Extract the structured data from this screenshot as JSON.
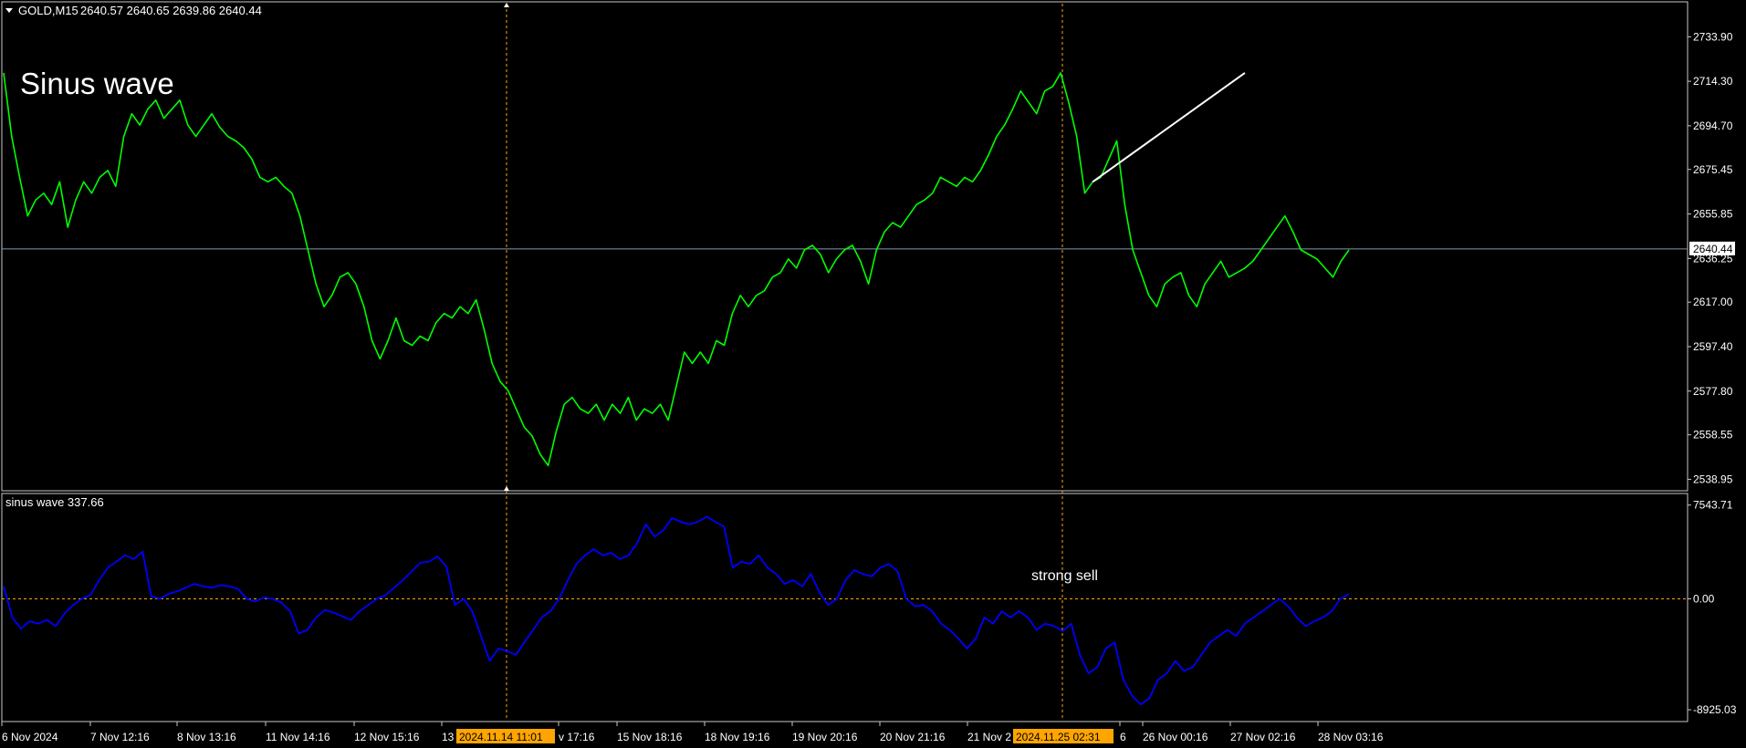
{
  "header": {
    "symbol": "GOLD,M15",
    "ohlc": "2640.57 2640.65 2639.86 2640.44"
  },
  "annotations": {
    "main_label": "Sinus wave",
    "signal_label": "strong sell",
    "current_price_tag": "2640.44",
    "cursor_tags": [
      "2024.11.14 11:01",
      "2024.11.25 02:31"
    ]
  },
  "indicator": {
    "title": "sinus wave 337.66"
  },
  "colors": {
    "background": "#000000",
    "price_line": "#00ff00",
    "indicator_line": "#0000ff",
    "crosshair": "#ffa500",
    "current_price_line": "#7f9bb3",
    "trendline": "#ffffff"
  },
  "chart_data": [
    {
      "type": "line",
      "title": "GOLD,M15",
      "series": [
        {
          "values": [
            2718,
            2690,
            2672,
            2655,
            2662,
            2665,
            2660,
            2670,
            2650,
            2662,
            2670,
            2665,
            2672,
            2675,
            2668,
            2690,
            2700,
            2695,
            2702,
            2706,
            2698,
            2702,
            2706,
            2695,
            2690,
            2695,
            2700,
            2694,
            2690,
            2688,
            2685,
            2680,
            2672,
            2670,
            2672,
            2668,
            2665,
            2655,
            2640,
            2625,
            2615,
            2620,
            2628,
            2630,
            2625,
            2615,
            2600,
            2592,
            2600,
            2610,
            2600,
            2598,
            2602,
            2600,
            2608,
            2612,
            2610,
            2615,
            2612,
            2618,
            2605,
            2590,
            2582,
            2578,
            2570,
            2562,
            2558,
            2550,
            2545,
            2560,
            2572,
            2575,
            2570,
            2568,
            2572,
            2565,
            2572,
            2568,
            2575,
            2565,
            2570,
            2568,
            2572,
            2565,
            2580,
            2595,
            2590,
            2595,
            2590,
            2600,
            2598,
            2612,
            2620,
            2615,
            2620,
            2622,
            2628,
            2630,
            2636,
            2632,
            2640,
            2642,
            2638,
            2630,
            2636,
            2640,
            2642,
            2635,
            2625,
            2640,
            2648,
            2652,
            2650,
            2655,
            2660,
            2662,
            2665,
            2672,
            2670,
            2668,
            2672,
            2670,
            2675,
            2682,
            2690,
            2695,
            2702,
            2710,
            2705,
            2700,
            2710,
            2712,
            2718,
            2705,
            2690,
            2665,
            2670,
            2672,
            2680,
            2688,
            2660,
            2640,
            2630,
            2620,
            2615,
            2625,
            2628,
            2630,
            2620,
            2615,
            2625,
            2630,
            2635,
            2628,
            2630,
            2632,
            2635,
            2640,
            2645,
            2650,
            2655,
            2648,
            2640,
            2638,
            2636,
            2632,
            2628,
            2635,
            2640
          ]
        }
      ],
      "ylim": [
        2533.9,
        2748.5
      ],
      "y_ticks": [
        "2733.90",
        "2714.30",
        "2694.70",
        "2675.45",
        "2655.85",
        "2636.25",
        "2617.00",
        "2597.40",
        "2577.80",
        "2558.55",
        "2538.95"
      ],
      "current_price": 2640.44,
      "trendline": {
        "from": [
          136,
          2670
        ],
        "to": [
          155,
          2718
        ]
      },
      "x_tick_labels": [
        "6 Nov 2024",
        "7 Nov 12:16",
        "8 Nov 13:16",
        "11 Nov 14:16",
        "12 Nov 15:16",
        "13",
        "v 17:16",
        "15 Nov 18:16",
        "18 Nov 19:16",
        "19 Nov 20:16",
        "20 Nov 21:16",
        "21 Nov 2",
        "6",
        "26 Nov 00:16",
        "27 Nov 02:16",
        "28 Nov 03:16"
      ]
    },
    {
      "type": "line",
      "title": "sinus wave 337.66",
      "series": [
        {
          "values": [
            1000,
            -1500,
            -2400,
            -1800,
            -2000,
            -1700,
            -2200,
            -1200,
            -500,
            0,
            300,
            1500,
            2500,
            3000,
            3500,
            3200,
            3800,
            200,
            0,
            400,
            600,
            900,
            1200,
            1000,
            900,
            1100,
            1000,
            800,
            0,
            -200,
            100,
            0,
            -300,
            -1000,
            -2800,
            -2500,
            -1500,
            -900,
            -1100,
            -1400,
            -1700,
            -1000,
            -500,
            0,
            300,
            900,
            1500,
            2200,
            2900,
            3000,
            3400,
            2600,
            -500,
            0,
            -1000,
            -3000,
            -5000,
            -4000,
            -4200,
            -4500,
            -3500,
            -2500,
            -1500,
            -1000,
            0,
            1500,
            2800,
            3500,
            4000,
            3500,
            3700,
            3200,
            3500,
            4500,
            6000,
            5000,
            5500,
            6500,
            6200,
            6000,
            6200,
            6600,
            6200,
            5800,
            2500,
            3000,
            2800,
            3500,
            2500,
            2000,
            1200,
            1500,
            1000,
            2000,
            500,
            -500,
            0,
            1500,
            2300,
            2000,
            1800,
            2500,
            2800,
            2200,
            0,
            -600,
            -500,
            -1000,
            -2000,
            -2500,
            -3200,
            -4000,
            -3200,
            -1500,
            -2000,
            -1000,
            -1500,
            -1000,
            -1500,
            -2500,
            -2000,
            -2200,
            -2600,
            -2000,
            -4500,
            -6000,
            -5500,
            -4000,
            -3500,
            -6500,
            -7800,
            -8500,
            -8000,
            -6500,
            -6000,
            -5000,
            -5800,
            -5500,
            -4500,
            -3500,
            -3000,
            -2500,
            -3000,
            -2000,
            -1500,
            -1000,
            -500,
            0,
            -600,
            -1500,
            -2200,
            -1800,
            -1500,
            -1000,
            0,
            400
          ],
          "color": "#0000ff"
        }
      ],
      "ylim": [
        -9800,
        8400
      ],
      "y_ticks": [
        "7543.71",
        "0.00",
        "-8925.03"
      ]
    }
  ]
}
